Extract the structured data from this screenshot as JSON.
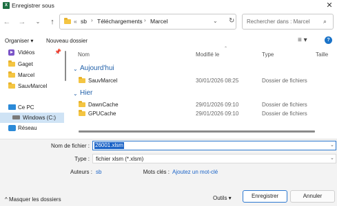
{
  "window": {
    "title": "Enregistrer sous",
    "app_icon_label": "X",
    "close_glyph": "✕"
  },
  "nav": {
    "back_glyph": "←",
    "forward_glyph": "→",
    "recent_glyph": "⌄",
    "up_glyph": "↑"
  },
  "address": {
    "overflow": "«",
    "crumbs": [
      "sb",
      "Téléchargements",
      "Marcel"
    ],
    "separator": "›",
    "dropdown_glyph": "⌄",
    "refresh_glyph": "↻"
  },
  "search": {
    "placeholder": "Rechercher dans : Marcel",
    "icon_glyph": "⌕"
  },
  "toolbar": {
    "organiser_label": "Organiser ▾",
    "new_folder_label": "Nouveau dossier",
    "view_glyph": "≡ ▾",
    "help_glyph": "?"
  },
  "sidebar": {
    "pin_glyph": "📌",
    "items": [
      {
        "label": "Vidéos",
        "icon": "video-icon"
      },
      {
        "label": "Gaget",
        "icon": "folder-icon"
      },
      {
        "label": "Marcel",
        "icon": "folder-icon"
      },
      {
        "label": "SauvMarcel",
        "icon": "folder-icon"
      },
      {
        "label": "Ce PC",
        "icon": "pc-icon"
      },
      {
        "label": "Windows (C:)",
        "icon": "drive-icon"
      },
      {
        "label": "Réseau",
        "icon": "network-icon"
      }
    ]
  },
  "filelist": {
    "columns": [
      "Nom",
      "Modifié le",
      "Type",
      "Taille"
    ],
    "sort_glyph": "⌃",
    "groups": [
      {
        "label": "Aujourd'hui",
        "caret": "⌄",
        "rows": [
          {
            "name": "SauvMarcel",
            "date": "30/01/2026 08:25",
            "type": "Dossier de fichiers"
          }
        ]
      },
      {
        "label": "Hier",
        "caret": "⌄",
        "rows": [
          {
            "name": "DawnCache",
            "date": "29/01/2026 09:10",
            "type": "Dossier de fichiers"
          },
          {
            "name": "GPUCache",
            "date": "29/01/2026 09:10",
            "type": "Dossier de fichiers"
          }
        ]
      }
    ]
  },
  "form": {
    "filename_label": "Nom de fichier :",
    "filename_value": "26001.xlsm",
    "type_label": "Type :",
    "type_value": "fichier xlsm (*.xlsm)",
    "authors_label": "Auteurs :",
    "authors_value": "sb",
    "tags_label": "Mots clés :",
    "tags_value": "Ajoutez un mot-clé",
    "dropdown_glyph": "⌄"
  },
  "footer": {
    "hide_folders_label": "^  Masquer les dossiers",
    "tools_label": "Outils  ▾",
    "save_label": "Enregistrer",
    "cancel_label": "Annuler"
  },
  "colors": {
    "accent": "#1a63c7",
    "folder": "#f4c542",
    "excel": "#1d6f42"
  }
}
